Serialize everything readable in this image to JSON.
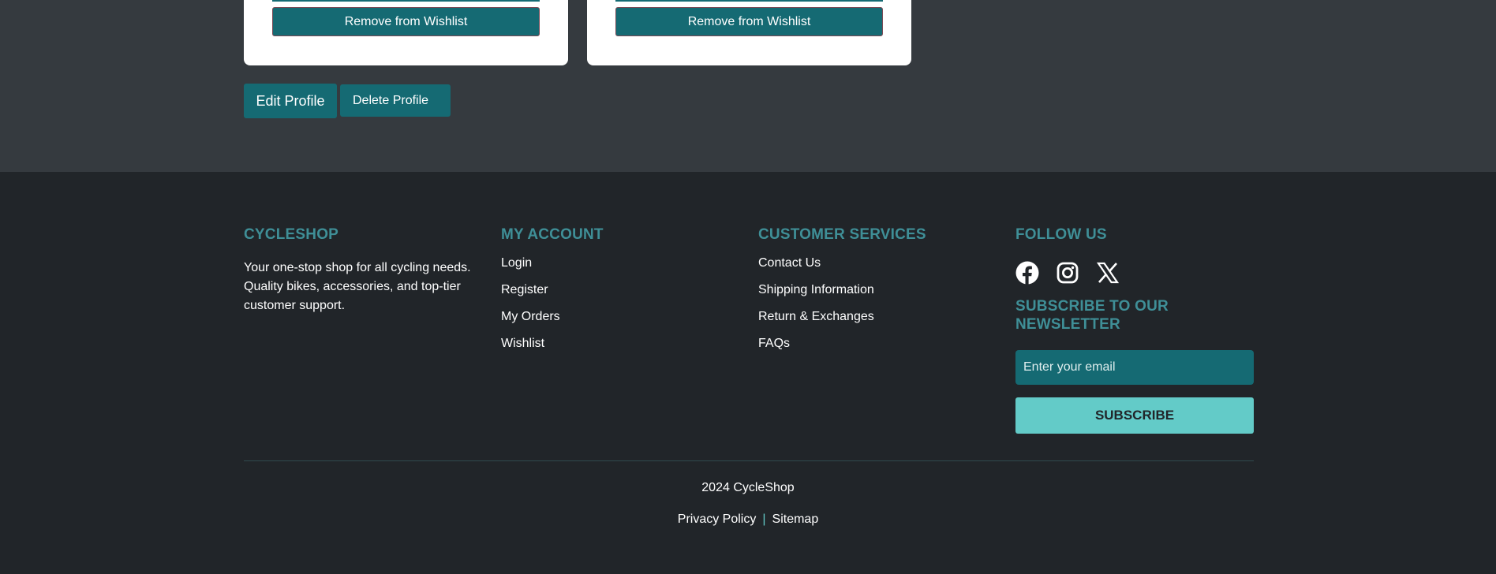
{
  "wishlist": {
    "cards": [
      {
        "remove_label": "Remove from Wishlist"
      },
      {
        "remove_label": "Remove from Wishlist"
      }
    ]
  },
  "profile_actions": {
    "edit_label": "Edit Profile",
    "delete_label": "Delete Profile"
  },
  "footer": {
    "brand": {
      "heading": "CYCLESHOP",
      "description": "Your one-stop shop for all cycling needs. Quality bikes, accessories, and top-tier customer support."
    },
    "account": {
      "heading": "MY ACCOUNT",
      "links": [
        "Login",
        "Register",
        "My Orders",
        "Wishlist"
      ]
    },
    "services": {
      "heading": "CUSTOMER SERVICES",
      "links": [
        "Contact Us",
        "Shipping Information",
        "Return & Exchanges",
        "FAQs"
      ]
    },
    "follow": {
      "heading": "FOLLOW US",
      "icons": [
        "facebook-icon",
        "instagram-icon",
        "x-icon"
      ]
    },
    "newsletter": {
      "heading": "SUBSCRIBE TO OUR NEWSLETTER",
      "placeholder": "Enter your email",
      "button_label": "SUBSCRIBE"
    },
    "copyright": "2024 CycleShop",
    "bottom_links": [
      "Privacy Policy",
      "Sitemap"
    ],
    "separator": "|"
  },
  "colors": {
    "accent": "#156a73",
    "heading": "#3f8f97",
    "subscribe": "#63cbc8",
    "footer_bg": "#212529",
    "profile_bg": "#353a3f"
  }
}
